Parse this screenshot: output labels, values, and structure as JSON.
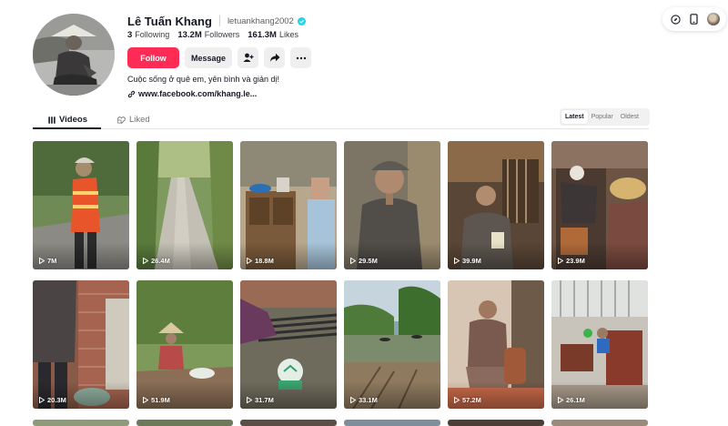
{
  "toolbar": {
    "icons": [
      "compass-icon",
      "phone-icon",
      "user-avatar"
    ]
  },
  "profile": {
    "display_name": "Lê Tuấn Khang",
    "username": "letuankhang2002",
    "verified": true,
    "stats": [
      {
        "value": "3",
        "label": "Following"
      },
      {
        "value": "13.2M",
        "label": "Followers"
      },
      {
        "value": "161.3M",
        "label": "Likes"
      }
    ],
    "follow_label": "Follow",
    "message_label": "Message",
    "bio": "Cuộc sống ở quê em, yên bình và giản dị!",
    "link": "www.facebook.com/khang.le..."
  },
  "tabs": [
    {
      "label": "Videos",
      "active": true
    },
    {
      "label": "Liked",
      "active": false
    }
  ],
  "sort": [
    {
      "label": "Latest",
      "active": true
    },
    {
      "label": "Popular",
      "active": false
    },
    {
      "label": "Oldest",
      "active": false
    }
  ],
  "videos": [
    {
      "views": "7M"
    },
    {
      "views": "26.4M"
    },
    {
      "views": "18.8M"
    },
    {
      "views": "29.5M"
    },
    {
      "views": "39.9M"
    },
    {
      "views": "23.9M"
    },
    {
      "views": "20.3M"
    },
    {
      "views": "51.9M"
    },
    {
      "views": "31.7M"
    },
    {
      "views": "33.1M"
    },
    {
      "views": "57.2M"
    },
    {
      "views": "26.1M"
    }
  ],
  "colors": {
    "follow": "#fe2c55",
    "verified": "#20d5ec",
    "text": "#161823"
  }
}
